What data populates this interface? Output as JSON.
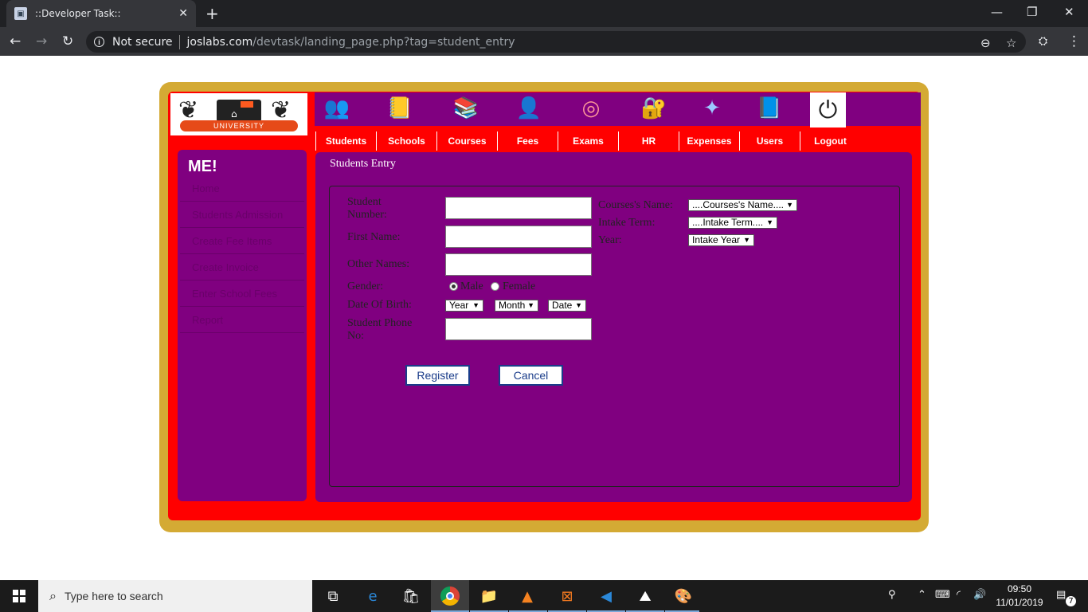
{
  "browser": {
    "tab_title": "::Developer Task::",
    "security_label": "Not secure",
    "url_domain": "joslabs.com",
    "url_path": "/devtask/landing_page.php?tag=student_entry"
  },
  "logo": {
    "ribbon_text": "UNIVERSITY"
  },
  "menu": {
    "items": [
      "Students",
      "Schools",
      "Courses",
      "Fees",
      "Exams",
      "HR",
      "Expenses",
      "Users",
      "Logout"
    ]
  },
  "sidebar": {
    "welcome": "ME!",
    "items": [
      "Home",
      "Students Admission",
      "Create Fee Items",
      "Create Invoice",
      "Enter School Fees",
      "Report"
    ]
  },
  "content": {
    "title": "Students Entry",
    "form": {
      "student_number_label": "Student Number:",
      "first_name_label": "First Name:",
      "other_names_label": "Other Names:",
      "gender_label": "Gender:",
      "gender_male": "Male",
      "gender_female": "Female",
      "dob_label": "Date Of Birth:",
      "dob_year": "Year",
      "dob_month": "Month",
      "dob_date": "Date",
      "phone_label": "Student Phone No:",
      "course_label": "Courses's Name:",
      "course_select": "....Courses's Name....",
      "intake_label": "Intake Term:",
      "intake_select": "....Intake Term....",
      "year_label": "Year:",
      "year_select": "Intake Year",
      "register_label": "Register",
      "cancel_label": "Cancel"
    }
  },
  "taskbar": {
    "search_placeholder": "Type here to search",
    "time": "09:50",
    "date": "11/01/2019",
    "notification_count": "7"
  }
}
